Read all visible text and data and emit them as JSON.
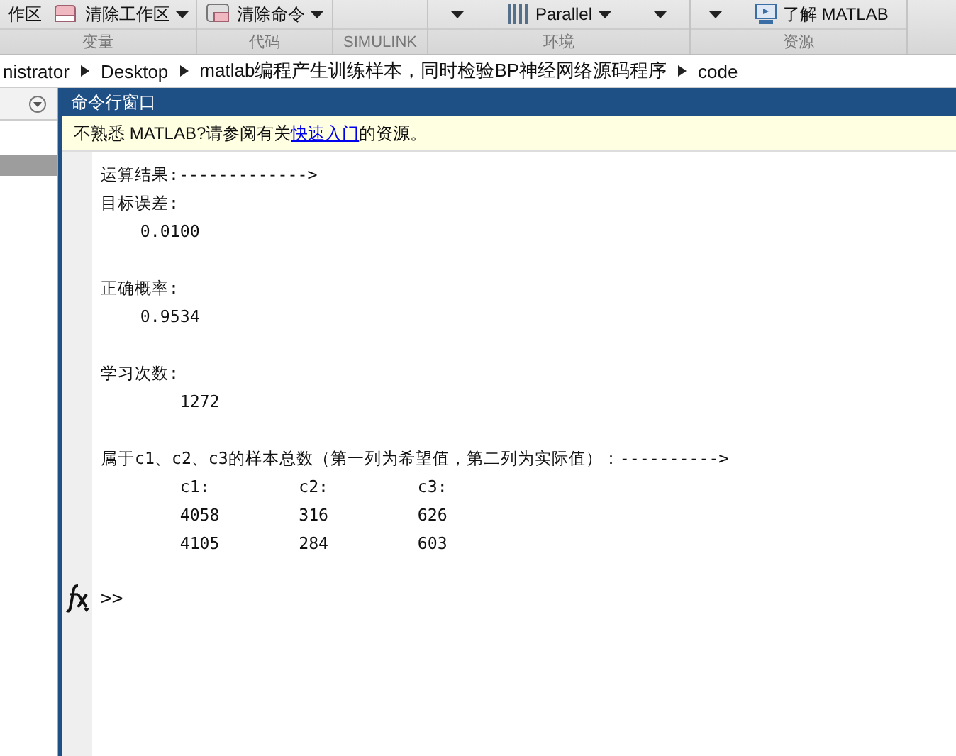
{
  "ribbon": {
    "groups": [
      {
        "label": "变量",
        "buttons": [
          {
            "kind": "plain",
            "label": "作区"
          },
          {
            "kind": "split",
            "label": "清除工作区"
          }
        ]
      },
      {
        "label": "代码",
        "buttons": [
          {
            "kind": "split",
            "label": "清除命令"
          }
        ]
      },
      {
        "label": "SIMULINK"
      },
      {
        "label": "环境",
        "buttons": [
          {
            "kind": "menu"
          },
          {
            "kind": "split",
            "label": "Parallel"
          },
          {
            "kind": "menu"
          }
        ]
      },
      {
        "label": "资源",
        "buttons": [
          {
            "kind": "menu"
          },
          {
            "kind": "plain",
            "label": "了解 MATLAB"
          }
        ]
      }
    ]
  },
  "address_bar": {
    "segments": [
      "nistrator",
      "Desktop",
      "matlab编程产生训练样本，同时检验BP神经网络源码程序",
      "code"
    ]
  },
  "command_window": {
    "title": "命令行窗口",
    "notice": {
      "before": "不熟悉 MATLAB?请参阅有关",
      "link": "快速入门",
      "after": "的资源。"
    },
    "blocks": [
      [
        "运算结果:------------->",
        "目标误差:",
        "    0.0100"
      ],
      [
        "正确概率:",
        "    0.9534"
      ],
      [
        "学习次数:",
        "        1272"
      ],
      [
        "属于c1、c2、c3的样本总数（第一列为希望值，第二列为实际值）：---------->",
        "        c1:         c2:         c3:",
        "        4058        316         626",
        "        4105        284         603"
      ]
    ],
    "prompt": ">>"
  }
}
